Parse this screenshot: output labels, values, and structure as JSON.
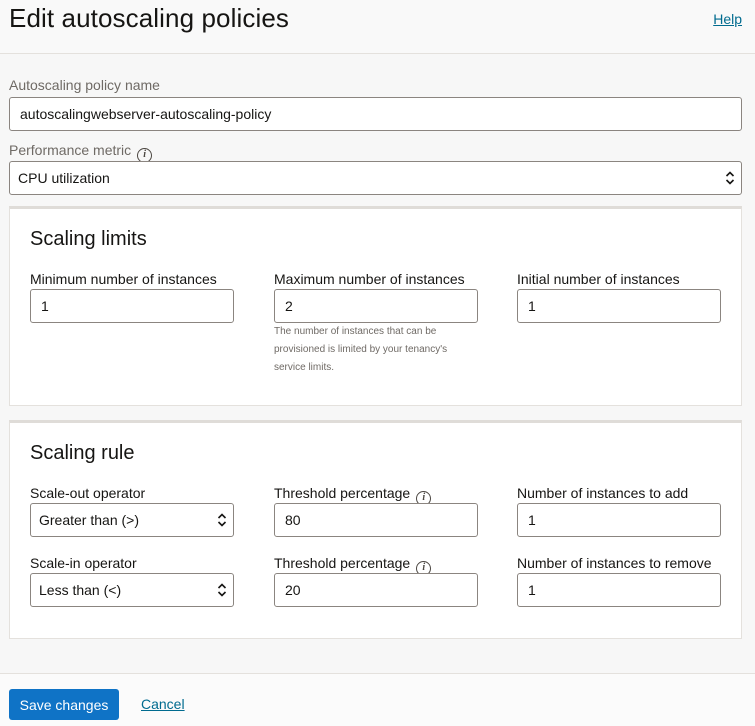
{
  "header": {
    "title": "Edit autoscaling policies",
    "help_label": "Help"
  },
  "policy_name": {
    "label": "Autoscaling policy name",
    "value": "autoscalingwebserver-autoscaling-policy"
  },
  "performance_metric": {
    "label": "Performance metric",
    "selected": "CPU utilization"
  },
  "scaling_limits": {
    "title": "Scaling limits",
    "min": {
      "label": "Minimum number of instances",
      "value": "1"
    },
    "max": {
      "label": "Maximum number of instances",
      "value": "2",
      "hint_lines": [
        "The number of instances that can be",
        "provisioned is limited by your tenancy's",
        "service limits."
      ]
    },
    "initial": {
      "label": "Initial number of instances",
      "value": "1"
    }
  },
  "scaling_rule": {
    "title": "Scaling rule",
    "scale_out": {
      "operator_label": "Scale-out operator",
      "operator_value": "Greater than (>)",
      "threshold_label": "Threshold percentage",
      "threshold_value": "80",
      "instances_label": "Number of instances to add",
      "instances_value": "1"
    },
    "scale_in": {
      "operator_label": "Scale-in operator",
      "operator_value": "Less than (<)",
      "threshold_label": "Threshold percentage",
      "threshold_value": "20",
      "instances_label": "Number of instances to remove",
      "instances_value": "1"
    }
  },
  "footer": {
    "save_label": "Save changes",
    "cancel_label": "Cancel"
  },
  "icons": {
    "info": "info-icon",
    "select_arrows": "updown-chevron-icon"
  },
  "colors": {
    "primary_button": "#0f73c6",
    "link": "#006b8f"
  }
}
